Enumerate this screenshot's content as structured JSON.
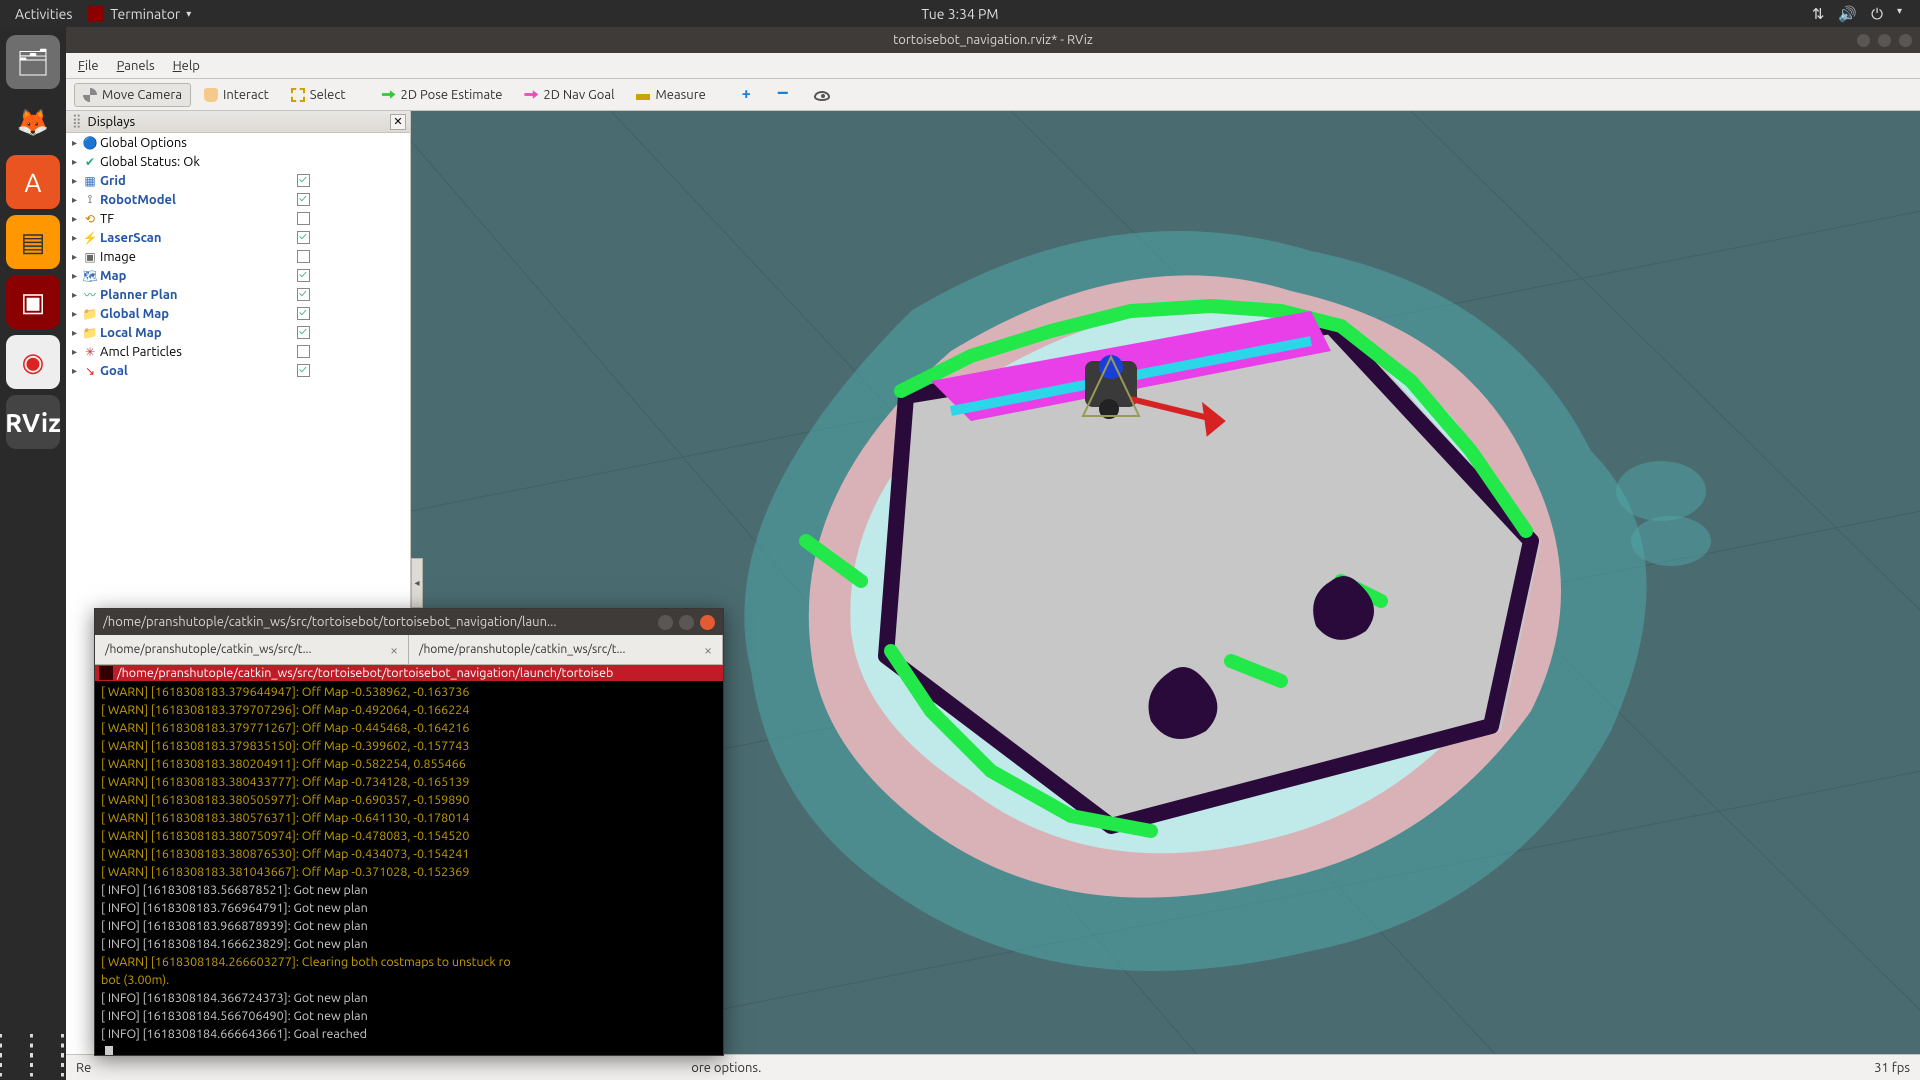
{
  "gnome": {
    "activities": "Activities",
    "app_name": "Terminator",
    "clock": "Tue  3:34 PM"
  },
  "rviz": {
    "title": "tortoisebot_navigation.rviz* - RViz",
    "menus": {
      "file": "File",
      "panels": "Panels",
      "help": "Help"
    },
    "toolbar": {
      "move_camera": "Move Camera",
      "interact": "Interact",
      "select": "Select",
      "pose_estimate": "2D Pose Estimate",
      "nav_goal": "2D Nav Goal",
      "measure": "Measure"
    },
    "displays": {
      "panel_title": "Displays",
      "items": [
        {
          "label": "Global Options",
          "icon": "globe",
          "checked": null,
          "bold": false
        },
        {
          "label": "Global Status: Ok",
          "icon": "check",
          "checked": null,
          "bold": false
        },
        {
          "label": "Grid",
          "icon": "grid",
          "checked": true,
          "bold": true
        },
        {
          "label": "RobotModel",
          "icon": "robot",
          "checked": true,
          "bold": true
        },
        {
          "label": "TF",
          "icon": "tf",
          "checked": false,
          "bold": false
        },
        {
          "label": "LaserScan",
          "icon": "laser",
          "checked": true,
          "bold": true
        },
        {
          "label": "Image",
          "icon": "image",
          "checked": false,
          "bold": false
        },
        {
          "label": "Map",
          "icon": "map",
          "checked": true,
          "bold": true
        },
        {
          "label": "Planner Plan",
          "icon": "plan",
          "checked": true,
          "bold": true
        },
        {
          "label": "Global Map",
          "icon": "folder",
          "checked": true,
          "bold": true
        },
        {
          "label": "Local Map",
          "icon": "folder",
          "checked": true,
          "bold": true
        },
        {
          "label": "Amcl Particles",
          "icon": "particles",
          "checked": false,
          "bold": false
        },
        {
          "label": "Goal",
          "icon": "goal",
          "checked": true,
          "bold": true
        }
      ]
    },
    "status": {
      "hint_fragment": "ore options.",
      "fps": "31 fps",
      "reset_fragment": "Re"
    }
  },
  "terminal": {
    "title": "/home/pranshutople/catkin_ws/src/tortoisebot/tortoisebot_navigation/laun...",
    "tab1": "/home/pranshutople/catkin_ws/src/t...",
    "tab2": "/home/pranshutople/catkin_ws/src/t...",
    "path_bar": "/home/pranshutople/catkin_ws/src/tortoisebot/tortoisebot_navigation/launch/tortoiseb",
    "lines": [
      {
        "t": "warn",
        "s": "[ WARN] [1618308183.379644947]: Off Map -0.538962, -0.163736"
      },
      {
        "t": "warn",
        "s": "[ WARN] [1618308183.379707296]: Off Map -0.492064, -0.166224"
      },
      {
        "t": "warn",
        "s": "[ WARN] [1618308183.379771267]: Off Map -0.445468, -0.164216"
      },
      {
        "t": "warn",
        "s": "[ WARN] [1618308183.379835150]: Off Map -0.399602, -0.157743"
      },
      {
        "t": "warn",
        "s": "[ WARN] [1618308183.380204911]: Off Map -0.582254, 0.855466"
      },
      {
        "t": "warn",
        "s": "[ WARN] [1618308183.380433777]: Off Map -0.734128, -0.165139"
      },
      {
        "t": "warn",
        "s": "[ WARN] [1618308183.380505977]: Off Map -0.690357, -0.159890"
      },
      {
        "t": "warn",
        "s": "[ WARN] [1618308183.380576371]: Off Map -0.641130, -0.178014"
      },
      {
        "t": "warn",
        "s": "[ WARN] [1618308183.380750974]: Off Map -0.478083, -0.154520"
      },
      {
        "t": "warn",
        "s": "[ WARN] [1618308183.380876530]: Off Map -0.434073, -0.154241"
      },
      {
        "t": "warn",
        "s": "[ WARN] [1618308183.381043667]: Off Map -0.371028, -0.152369"
      },
      {
        "t": "info",
        "s": "[ INFO] [1618308183.566878521]: Got new plan"
      },
      {
        "t": "info",
        "s": "[ INFO] [1618308183.766964791]: Got new plan"
      },
      {
        "t": "info",
        "s": "[ INFO] [1618308183.966878939]: Got new plan"
      },
      {
        "t": "info",
        "s": "[ INFO] [1618308184.166623829]: Got new plan"
      },
      {
        "t": "warn",
        "s": "[ WARN] [1618308184.266603277]: Clearing both costmaps to unstuck ro"
      },
      {
        "t": "warn",
        "s": "bot (3.00m)."
      },
      {
        "t": "info",
        "s": "[ INFO] [1618308184.366724373]: Got new plan"
      },
      {
        "t": "info",
        "s": "[ INFO] [1618308184.566706490]: Got new plan"
      },
      {
        "t": "info",
        "s": "[ INFO] [1618308184.666643661]: Goal reached"
      }
    ]
  }
}
